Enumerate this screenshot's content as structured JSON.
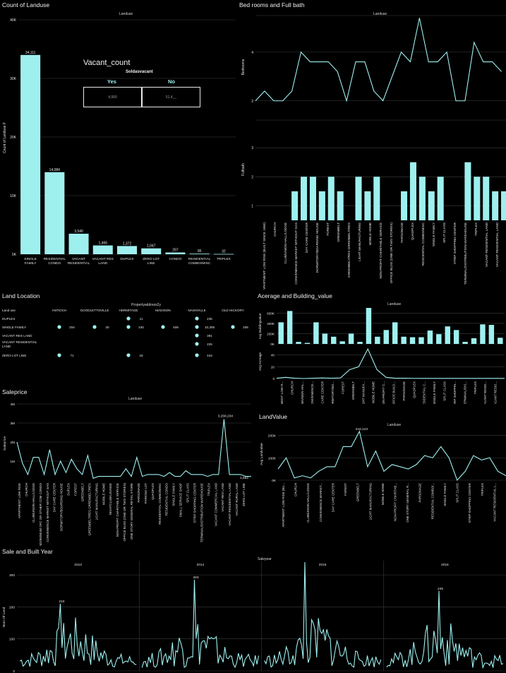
{
  "colors": {
    "bg": "#000000",
    "mark": "#9ef0ef",
    "grid": "#3c3c3c",
    "text": "#e6e6e6"
  },
  "landuse_count": {
    "title": "Count of Landuse",
    "subtitle": "Landuse",
    "chart_data": {
      "type": "bar",
      "categories": [
        "SINGLE FAMILY",
        "RESIDENTIAL CONDO",
        "VACANT RESIDENTIAL LAND",
        "VACANT RES LAND",
        "DUPLEX",
        "ZERO LOT LINE",
        "CONDO",
        "RESIDENTIAL COMBO/MISC",
        "TRIPLEX"
      ],
      "values": [
        34000,
        14000,
        3500,
        1500,
        1400,
        1000,
        300,
        100,
        50
      ],
      "value_labels": [
        "34,111",
        "14,084",
        "3,540",
        "1,466",
        "1,372",
        "1,047",
        "297",
        "95",
        "32"
      ],
      "ylabel": "Count of Landuse F",
      "yticks": [
        "0K",
        "10K",
        "20K",
        "30K",
        "40K"
      ],
      "ylim": [
        0,
        40000
      ]
    }
  },
  "vacant_count": {
    "title": "Vacant_count",
    "subtitle": "Soldasvacant",
    "headers": [
      "Yes",
      "No"
    ],
    "values": [
      "4,990",
      "51,4__"
    ]
  },
  "bedrooms_bath": {
    "title": "Bed rooms and Full bath",
    "subtitle": "Landuse",
    "chart_data": [
      {
        "type": "line",
        "ylabel": "Bedrooms",
        "yticks": [
          "2",
          "4"
        ],
        "ylim": [
          1.5,
          5.5
        ],
        "values": [
          2,
          2.4,
          2,
          2,
          2.4,
          4,
          3.6,
          3.6,
          3.6,
          3.2,
          2,
          3.6,
          3.6,
          2.4,
          2,
          3,
          4,
          3.6,
          5.4,
          3.6,
          3.6,
          4,
          2,
          2,
          4.4,
          3.6,
          3.6,
          3.2
        ]
      },
      {
        "type": "bar",
        "ylabel": "Fullbath",
        "yticks": [
          "1",
          "2",
          "3"
        ],
        "ylim": [
          0.5,
          4
        ],
        "values": [
          0,
          0,
          0,
          0,
          1.5,
          2,
          2,
          1.5,
          2,
          1.5,
          0,
          2,
          1.5,
          2,
          0,
          0,
          1.5,
          2.5,
          2,
          1.5,
          2,
          0,
          0,
          2.5,
          2,
          2,
          1.5,
          1.5
        ],
        "categories": [
          "APARTMENT: LOW RISE (BUILT SINCE 1960)",
          "CHURCH",
          "CLUB/UNION HALL/LODGE",
          "CONVENIENCE MARKET WITHOUT GAS",
          "DAY CARE CENTER",
          "DORMITORY/BOARDING HOUSE",
          "FOREST",
          "GREENBELT",
          "GREENBELT/RES GRRENBELT/RES",
          "LIGHT MANUFACTURING",
          "MOBILE HOME",
          "NON-PROFIT CHARITABLE SERVICE",
          "OFFICE BLDG (ONE OR TWO STORIES)",
          "PARSONAGE",
          "QUADPLEX",
          "RESIDENTIAL COMBO/MISC",
          "SINGLE FAMILY",
          "SPLIT CLASS",
          "STRIP SHOPPING CENTER",
          "TERMINAL/DISTRIBUTION WAREHOUSE",
          "TRIPLEX",
          "VACANT RESIDENTIAL LAND",
          "VACANT RESIDENTIAL LAND"
        ]
      }
    ]
  },
  "land_location": {
    "title": "Land Location",
    "subtitle": "Propertyaddress2y",
    "row_header": "Land use",
    "columns": [
      "ANTIOCH",
      "GOODLETTSVILLE",
      "HERMITAGE",
      "MADISON",
      "NASHVILLE",
      "OLD HICKORY"
    ],
    "rows": [
      {
        "label": "DUPLEX",
        "cells": [
          "",
          "",
          "11",
          "",
          "236",
          ""
        ]
      },
      {
        "label": "SINGLE FAMILY",
        "cells": [
          "204",
          "20",
          "240",
          "409",
          "10,305",
          "206"
        ]
      },
      {
        "label": "VACANT RES LAND",
        "cells": [
          "",
          "",
          "",
          "",
          "391",
          ""
        ]
      },
      {
        "label": "VACANT RESIDENTIAL LAND",
        "cells": [
          "",
          "",
          "",
          "",
          "225",
          ""
        ]
      },
      {
        "label": "ZERO LOT LINE",
        "cells": [
          "71",
          "",
          "18",
          "",
          "444",
          ""
        ]
      }
    ]
  },
  "acreage_building": {
    "title": "Acerage and Building_value",
    "subtitle": "Landuse",
    "chart_data": [
      {
        "type": "bar",
        "ylabel": "Avg Buildingvalue",
        "yticks": [
          "0K",
          "200K",
          "400K",
          "600K"
        ],
        "ylim": [
          0,
          700000
        ],
        "values": [
          420000,
          640000,
          40000,
          20000,
          420000,
          200000,
          140000,
          50000,
          200000,
          40000,
          700000,
          140000,
          270000,
          420000,
          140000,
          130000,
          130000,
          260000,
          190000,
          340000,
          270000,
          40000,
          110000,
          380000,
          370000,
          120000
        ]
      },
      {
        "type": "line",
        "ylabel": "Avg Acreage",
        "yticks": [
          "0",
          "20",
          "40"
        ],
        "ylim": [
          0,
          55
        ],
        "values": [
          0.5,
          2,
          0.5,
          0,
          0.5,
          1,
          0.5,
          1,
          15,
          20,
          50,
          15,
          2,
          0.5,
          0.5,
          0.3,
          0.2,
          0.2,
          0.2,
          0.2,
          0.2,
          0.2,
          0.2,
          0.2,
          0.2,
          0.2
        ],
        "categories": [
          "APARTMENT: LOW R...",
          "CHURCH",
          "CLUB/UNION HAL...",
          "CONVENIENCE...",
          "DAY CARE CENTER",
          "DORMITORY/BO...",
          "FOREST",
          "GREENBELT",
          "LIGHT MANUFA...",
          "MOBILE HOME",
          "NON-PROFIT C...",
          "OFFICE BUILD...",
          "PARSONAGE",
          "QUADPLEX",
          "RESIDENTIAL C...",
          "SINGLE FAMILY",
          "SPLIT CLASS",
          "STRIP SHOPPIN...",
          "TERMINAL/DIS...",
          "TRIPLEX",
          "VACANT RESID...",
          "VACANT RESID..."
        ]
      }
    ]
  },
  "saleprice": {
    "title": "Saleprice",
    "subtitle": "Landuse",
    "chart_data": {
      "type": "line",
      "ylabel": "Saleprice",
      "yticks": [
        "1M",
        "2M",
        "3M",
        "4M"
      ],
      "ylim": [
        0,
        4000000
      ],
      "values": [
        2000000,
        900000,
        300000,
        1200000,
        1200000,
        300000,
        1600000,
        300000,
        1000000,
        400000,
        1100000,
        600000,
        300000,
        1300000,
        100000,
        200000,
        200000,
        200000,
        200000,
        200000,
        600000,
        200000,
        1200000,
        200000,
        300000,
        300000,
        300000,
        200000,
        400000,
        200000,
        200000,
        500000,
        300000,
        300000,
        300000,
        200000,
        300000,
        300000,
        3200000,
        300000,
        300000,
        300000,
        200000,
        200000
      ],
      "annotations": [
        "3,258,204",
        "1,682"
      ],
      "categories": [
        "APARTMENT: LOW RISE",
        "CHURCH",
        "CLUB/UNION HALL/LODGE",
        "CONDOMINIUM OFC OR OTHER COM CONDO",
        "CONVENIENCE MARKET WITHOUT GAS",
        "DAY CARE CENTER",
        "DORMITORY/BOARDING HOUSE",
        "DUPLEX",
        "FOREST",
        "GREENBELT",
        "GREENBELT/RES GRRENBELT/RES",
        "LIGHT MANUFACTURING",
        "MOBILE HOME",
        "NIGHTCLUB/LOUNGE",
        "NON-PROFIT CHARITABLE SERVICE",
        "OFFICE BLDG (ONE OR TWO STORIES)",
        "ONE STORY GENERAL RETAIL STORE",
        "PARSONAGE",
        "PARKING LOT",
        "QUADPLEX",
        "RESIDENTIAL COMBO/MISC",
        "RESIDENTIAL CONDO",
        "SINGLE FAMILY",
        "SMALL SERVICE SHOP",
        "SPLIT CLASS",
        "STRIP SHOPPING CENTER",
        "TERMINAL/DISTRIBUTION WAREHOUSE",
        "TRIPLEX",
        "VACANT COMMERCIAL LAND",
        "VACANT RES LAND",
        "VACANT RESIDENTIAL LAND",
        "VACANT RURAL LAND",
        "ZERO LOT LINE"
      ]
    }
  },
  "landvalue": {
    "title": "LandValue",
    "subtitle": "Landuse",
    "chart_data": {
      "type": "line",
      "ylabel": "Avg Landvalue",
      "yticks": [
        "0K",
        "100K",
        "200K"
      ],
      "ylim": [
        0,
        230000
      ],
      "values": [
        50000,
        100000,
        10000,
        20000,
        10000,
        40000,
        60000,
        60000,
        150000,
        150000,
        218000,
        60000,
        130000,
        40000,
        70000,
        60000,
        50000,
        70000,
        110000,
        100000,
        150000,
        100000,
        0,
        40000,
        110000,
        90000,
        100000,
        40000,
        20000
      ],
      "annotations": [
        "218,123"
      ],
      "categories": [
        "APARTMENT: LOW RISE (BU...",
        "CHURCH",
        "CLUB/UNION HALL/LODGE",
        "CONVENIENCE MARKET...",
        "DAY CARE CENTER",
        "FOREST",
        "GREENBELT",
        "LIGHT MANUFACTURING",
        "MOBILE HOME",
        "NON-PROFIT CHARITAB...",
        "ONE STORY GENERAL R...",
        "PARSONAGE",
        "RESIDENTIAL COMBO/...",
        "SINGLE FAMILY",
        "SPLIT CLASS",
        "STRIP SHOPPING CENTER",
        "TRIPLEX",
        "VACANT RESIDENTIAL L..."
      ]
    }
  },
  "sale_built_year": {
    "title": "Sale and Built Year",
    "subtitle": "Saleyear",
    "ylabel": "Num Of Land",
    "yticks": [
      "0",
      "100",
      "200",
      "300"
    ],
    "ylim": [
      0,
      340
    ],
    "chart_data": {
      "type": "line",
      "facets": [
        "2013",
        "2014",
        "2015",
        "2016"
      ],
      "peaks": [
        210,
        285,
        340,
        250
      ],
      "annotations": [
        "210",
        "283",
        "",
        "245"
      ]
    }
  }
}
